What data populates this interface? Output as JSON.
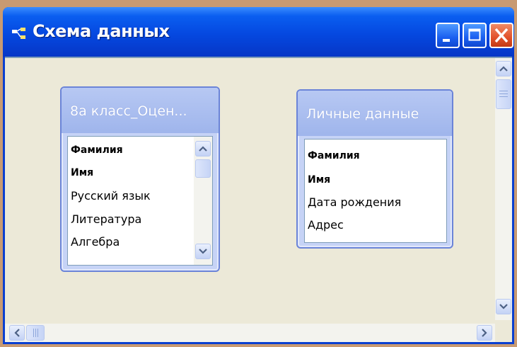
{
  "window": {
    "title": "Схема данных",
    "colors": {
      "titlebar": "#0548e0",
      "close": "#e2512a",
      "client": "#ece9d8",
      "table_header": "#9fb5ec"
    }
  },
  "tables": [
    {
      "title": "8а класс_Оцен...",
      "fields": [
        {
          "label": "Фамилия",
          "key": true
        },
        {
          "label": "Имя",
          "key": true
        },
        {
          "label": "Русский язык",
          "key": false
        },
        {
          "label": "Литература",
          "key": false
        },
        {
          "label": "Алгебра",
          "key": false
        }
      ]
    },
    {
      "title": "Личные данные",
      "fields": [
        {
          "label": "Фамилия",
          "key": true
        },
        {
          "label": "Имя",
          "key": true
        },
        {
          "label": "Дата рождения",
          "key": false
        },
        {
          "label": "Адрес",
          "key": false
        }
      ]
    }
  ],
  "icons": {
    "app": "relationships-icon",
    "minimize": "minimize-icon",
    "maximize": "maximize-icon",
    "close": "close-icon",
    "scroll_up": "chevron-up-icon",
    "scroll_down": "chevron-down-icon",
    "scroll_left": "chevron-left-icon",
    "scroll_right": "chevron-right-icon"
  }
}
